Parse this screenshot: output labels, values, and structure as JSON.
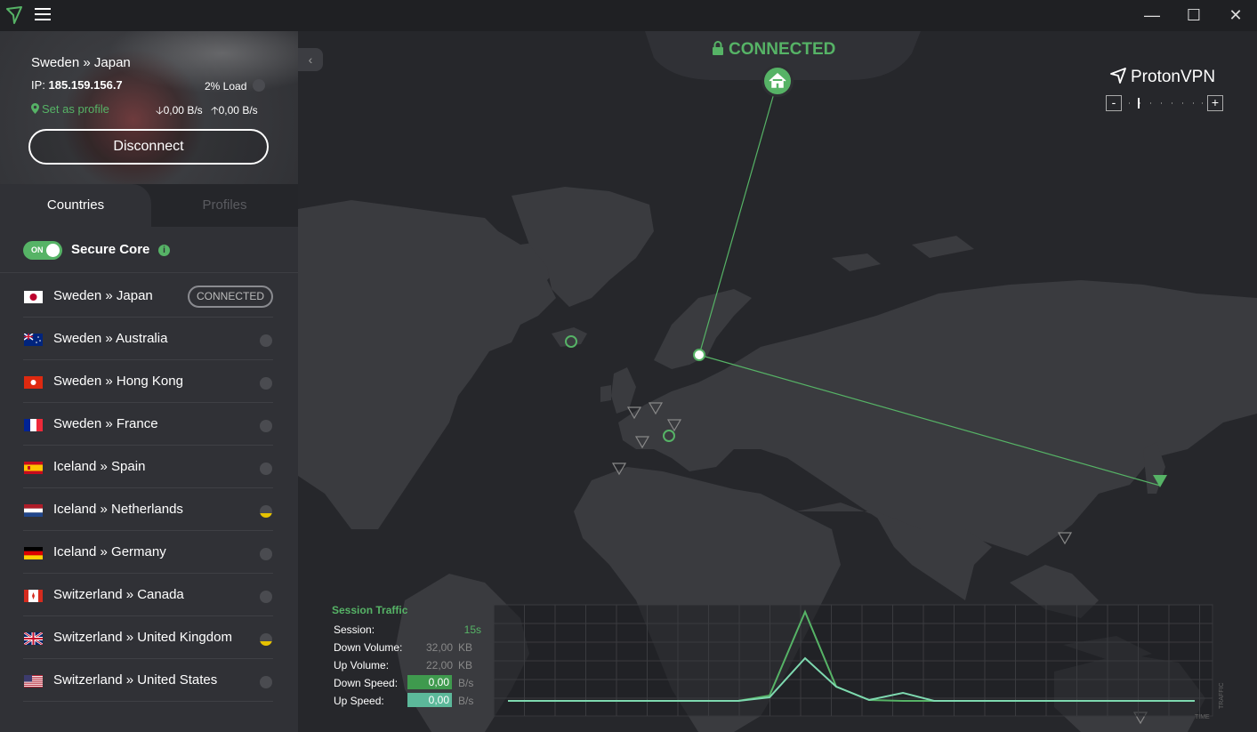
{
  "colors": {
    "accent": "#56b366",
    "medium_load": "#e6c200",
    "bg": "#26272b",
    "land": "#3a3b3f"
  },
  "titlebar": {
    "menu_icon": "hamburger-icon",
    "logo_icon": "protonvpn-logo-icon",
    "minimize": "—",
    "maximize": "☐",
    "close": "✕"
  },
  "connection": {
    "route": "Sweden » Japan",
    "ip_label": "IP:",
    "ip_value": "185.159.156.7",
    "load": "2% Load",
    "set_as_profile": "Set as profile",
    "down_speed": "0,00 B/s",
    "up_speed": "0,00 B/s",
    "disconnect_label": "Disconnect"
  },
  "tabs": {
    "countries": "Countries",
    "profiles": "Profiles"
  },
  "secure_core": {
    "toggle_text": "ON",
    "label": "Secure Core",
    "enabled": true
  },
  "servers": [
    {
      "name": "Sweden » Japan",
      "flag": "jp",
      "status": "CONNECTED",
      "load": "low"
    },
    {
      "name": "Sweden » Australia",
      "flag": "au",
      "load": "low"
    },
    {
      "name": "Sweden » Hong Kong",
      "flag": "hk",
      "load": "low"
    },
    {
      "name": "Sweden » France",
      "flag": "fr",
      "load": "low"
    },
    {
      "name": "Iceland » Spain",
      "flag": "es",
      "load": "low"
    },
    {
      "name": "Iceland » Netherlands",
      "flag": "nl",
      "load": "medium"
    },
    {
      "name": "Iceland » Germany",
      "flag": "de",
      "load": "low"
    },
    {
      "name": "Switzerland » Canada",
      "flag": "ca",
      "load": "low"
    },
    {
      "name": "Switzerland » United Kingdom",
      "flag": "gb",
      "load": "medium"
    },
    {
      "name": "Switzerland » United States",
      "flag": "us",
      "load": "low"
    }
  ],
  "map": {
    "status": "CONNECTED",
    "brand": "ProtonVPN",
    "zoom_out": "-",
    "zoom_in": "+",
    "zoom_level": 0
  },
  "session_traffic": {
    "title": "Session Traffic",
    "session_label": "Session:",
    "session_value": "15s",
    "down_volume_label": "Down Volume:",
    "down_volume_value": "32,00",
    "down_volume_unit": "KB",
    "up_volume_label": "Up Volume:",
    "up_volume_value": "22,00",
    "up_volume_unit": "KB",
    "down_speed_label": "Down Speed:",
    "down_speed_value": "0,00",
    "down_speed_unit": "B/s",
    "up_speed_label": "Up Speed:",
    "up_speed_value": "0,00",
    "up_speed_unit": "B/s",
    "x_axis": "TIME",
    "y_axis": "TRAFFIC"
  }
}
